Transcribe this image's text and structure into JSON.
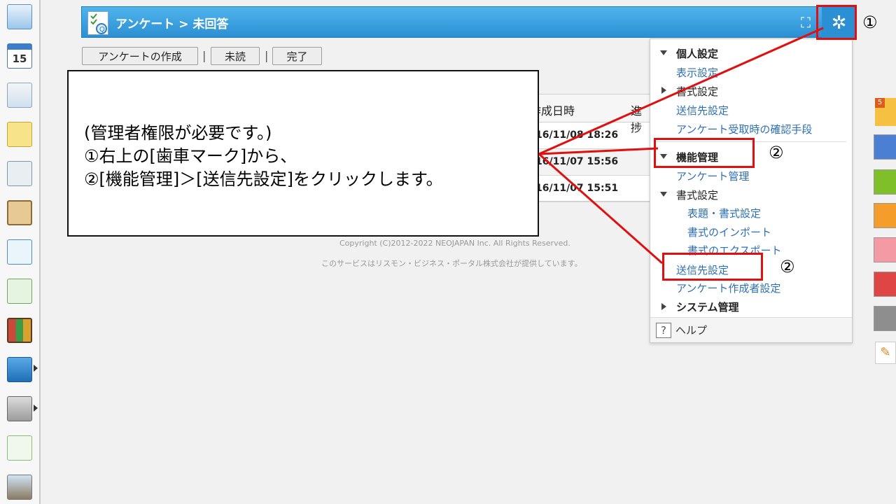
{
  "header": {
    "title": "アンケート > 未回答",
    "expand_icon": "expand-icon",
    "settings_icon": "gear-icon"
  },
  "toolbar": {
    "create_label": "アンケートの作成",
    "separator": "|",
    "unread_label": "未読",
    "done_label": "完了"
  },
  "table": {
    "headers": [
      "作成日時",
      "進捗"
    ],
    "rows": [
      "16/11/08 18:26",
      "16/11/07 15:56",
      "16/11/07 15:51"
    ]
  },
  "footer": {
    "copyright": "Copyright (C)2012-2022 NEOJAPAN Inc. All Rights Reserved.",
    "provider": "このサービスはリスモン・ビジネス・ポータル株式会社が提供しています。"
  },
  "callout": {
    "line1": "(管理者権限が必要です。)",
    "line2": "①右上の[歯車マーク]から、",
    "line3": "②[機能管理]＞[送信先設定]をクリックします。"
  },
  "settings_menu": {
    "personal": {
      "label": "個人設定",
      "items": [
        "表示設定",
        "書式設定",
        "送信先設定",
        "アンケート受取時の確認手段"
      ]
    },
    "function": {
      "label": "機能管理",
      "survey_admin": "アンケート管理",
      "format_settings": "書式設定",
      "format_items": [
        "表題・書式設定",
        "書式のインポート",
        "書式のエクスポート"
      ],
      "destination": "送信先設定",
      "creator": "アンケート作成者設定"
    },
    "system": "システム管理",
    "help": "ヘルプ",
    "help_icon_glyph": "?"
  },
  "annotations": {
    "step1": "①",
    "step2": "②"
  },
  "colors": {
    "accent": "#2b8fd3",
    "highlight": "#e01010",
    "link": "#2d6fb5"
  }
}
